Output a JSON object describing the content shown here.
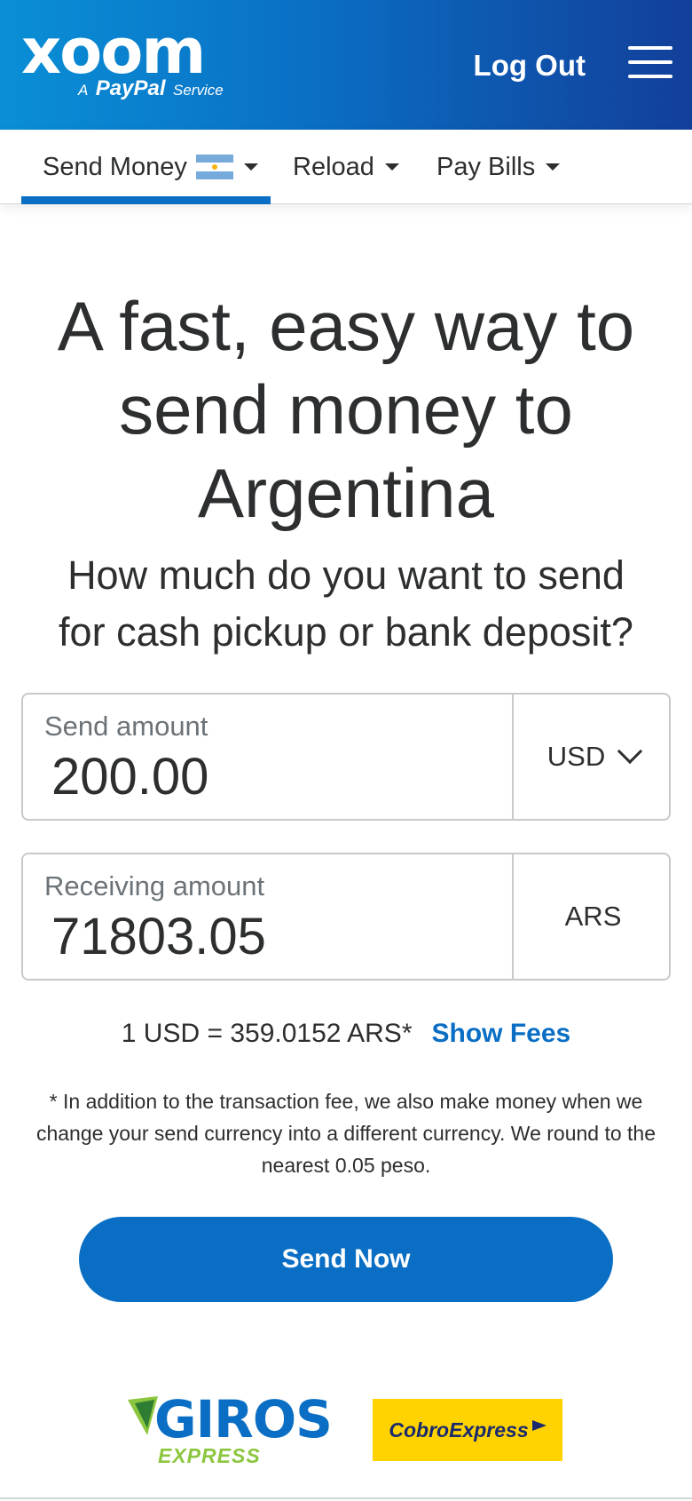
{
  "header": {
    "logo_word": "xoom",
    "logo_prefix": "A",
    "logo_brand": "PayPal",
    "logo_suffix": "Service",
    "logout_label": "Log Out",
    "menu_icon": "hamburger-icon"
  },
  "nav": {
    "items": [
      {
        "label": "Send Money",
        "active": true,
        "flag": "argentina-flag-icon"
      },
      {
        "label": "Reload",
        "active": false
      },
      {
        "label": "Pay Bills",
        "active": false
      }
    ]
  },
  "hero": {
    "title_line1": "A fast, easy way to",
    "title_line2": "send money to",
    "title_line3": "Argentina",
    "subtitle_line1": "How much do you want to send",
    "subtitle_line2": "for cash pickup or bank deposit?"
  },
  "send": {
    "label": "Send amount",
    "value": "200.00",
    "currency": "USD"
  },
  "receive": {
    "label": "Receiving amount",
    "value": "71803.05",
    "currency": "ARS"
  },
  "rate": {
    "text": "1 USD = 359.0152 ARS*",
    "fees_link": "Show Fees"
  },
  "disclaimer": "* In addition to the transaction fee, we also make money when we change your send currency into a different currency. We round to the nearest 0.05 peso.",
  "cta": {
    "send_now": "Send Now"
  },
  "partners": {
    "giros_word": "GIROS",
    "giros_sub": "EXPRESS",
    "cobro": "CobroExpress"
  },
  "colors": {
    "brand_blue": "#0a6fc4",
    "header_start": "#0a8fd6",
    "header_end": "#123f9a",
    "giros_green": "#8cc63f",
    "cobro_yellow": "#ffd200"
  }
}
